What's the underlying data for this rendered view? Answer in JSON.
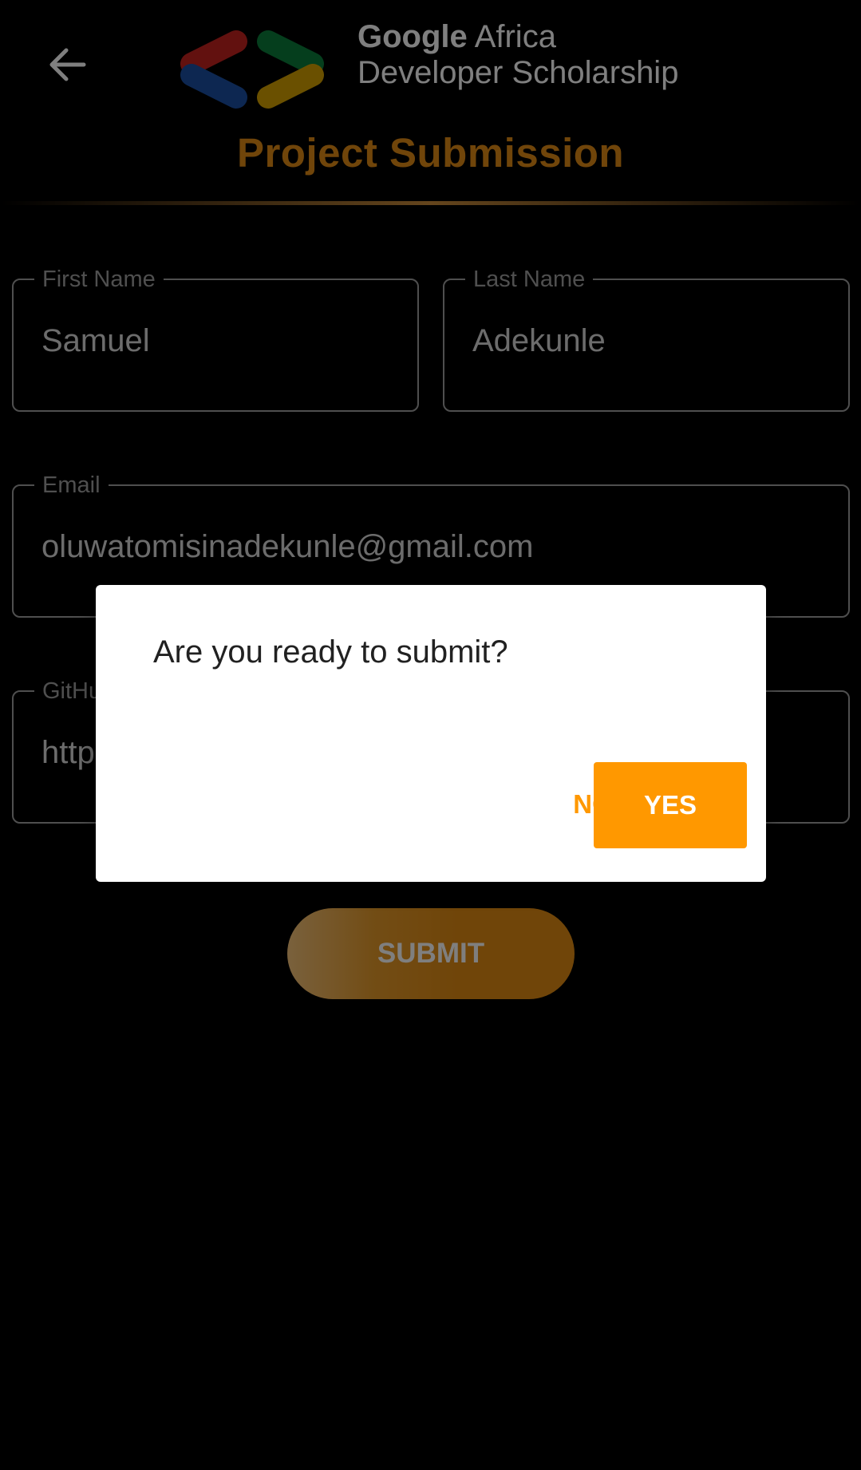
{
  "header": {
    "back_icon": "arrow-left-icon",
    "logo_icon": "gads-chevrons-logo",
    "logo_brand": "Google",
    "logo_line1_rest": "Africa",
    "logo_line2": "Developer Scholarship",
    "page_title": "Project Submission"
  },
  "form": {
    "first_name": {
      "label": "First Name",
      "value": "Samuel"
    },
    "last_name": {
      "label": "Last Name",
      "value": "Adekunle"
    },
    "email": {
      "label": "Email",
      "value": "oluwatomisinadekunle@gmail.com"
    },
    "github": {
      "label": "GitHu",
      "value": "http"
    },
    "submit_label": "SUBMIT"
  },
  "dialog": {
    "message": "Are you ready to submit?",
    "no_label": "NO",
    "yes_label": "YES"
  },
  "colors": {
    "accent": "#ff9800",
    "title": "#e08a14",
    "logo_red": "#c5221f",
    "logo_blue": "#1a4fa3",
    "logo_green": "#0b7d3a",
    "logo_yellow": "#d4a100"
  }
}
